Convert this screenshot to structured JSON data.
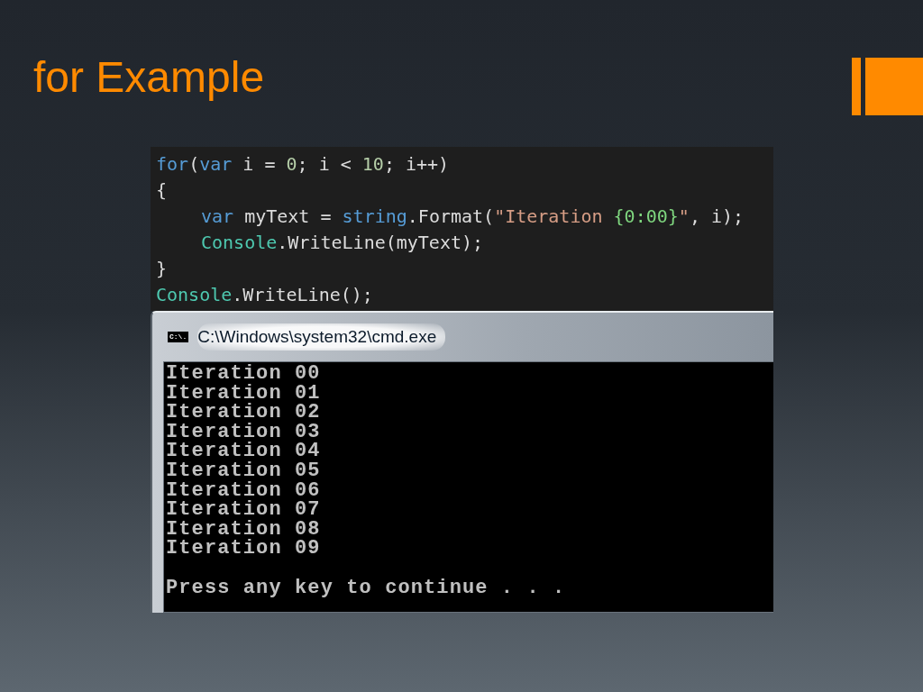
{
  "title": "for Example",
  "code_lines": [
    {
      "indented": false,
      "tokens": [
        {
          "text": "for",
          "kind": "keyword"
        },
        {
          "text": "(",
          "kind": "plain"
        },
        {
          "text": "var",
          "kind": "keyword"
        },
        {
          "text": " i = ",
          "kind": "plain"
        },
        {
          "text": "0",
          "kind": "number"
        },
        {
          "text": "; i < ",
          "kind": "plain"
        },
        {
          "text": "10",
          "kind": "number"
        },
        {
          "text": "; i++)",
          "kind": "plain"
        }
      ]
    },
    {
      "indented": false,
      "tokens": [
        {
          "text": "{",
          "kind": "plain"
        }
      ]
    },
    {
      "indented": true,
      "tokens": [
        {
          "text": "var",
          "kind": "keyword"
        },
        {
          "text": " myText = ",
          "kind": "plain"
        },
        {
          "text": "string",
          "kind": "keyword"
        },
        {
          "text": ".Format(",
          "kind": "plain"
        },
        {
          "text": "\"Iteration ",
          "kind": "string"
        },
        {
          "text": "{0:00}",
          "kind": "format"
        },
        {
          "text": "\"",
          "kind": "string"
        },
        {
          "text": ", i);",
          "kind": "plain"
        }
      ]
    },
    {
      "indented": true,
      "tokens": [
        {
          "text": "Console",
          "kind": "type"
        },
        {
          "text": ".WriteLine(myText);",
          "kind": "plain"
        }
      ]
    },
    {
      "indented": false,
      "tokens": [
        {
          "text": "}",
          "kind": "plain"
        }
      ]
    },
    {
      "indented": false,
      "tokens": [
        {
          "text": "Console",
          "kind": "type"
        },
        {
          "text": ".WriteLine();",
          "kind": "plain"
        }
      ]
    }
  ],
  "console_window": {
    "title": "C:\\Windows\\system32\\cmd.exe",
    "icon_text": "C:\\.",
    "lines": [
      "Iteration 00",
      "Iteration 01",
      "Iteration 02",
      "Iteration 03",
      "Iteration 04",
      "Iteration 05",
      "Iteration 06",
      "Iteration 07",
      "Iteration 08",
      "Iteration 09"
    ],
    "prompt": "Press any key to continue . . ."
  }
}
